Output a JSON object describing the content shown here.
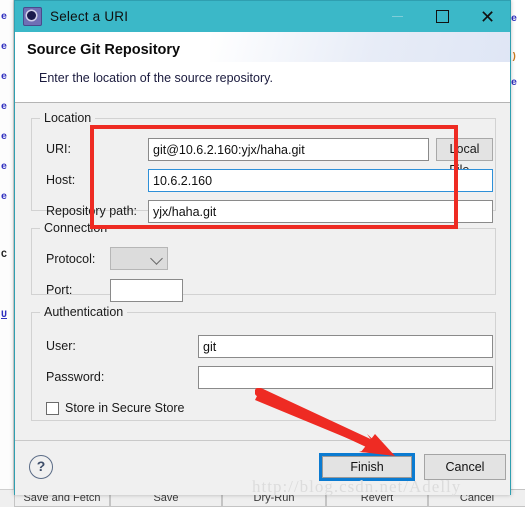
{
  "window": {
    "title": "Select a URI",
    "icon": "gear-icon",
    "controls": {
      "minimize": "—",
      "maximize": "☐",
      "close": "✕"
    },
    "titlebar_color": "#3bb8c8"
  },
  "header": {
    "title": "Source Git Repository",
    "description": "Enter the location of the source repository."
  },
  "location": {
    "legend": "Location",
    "uri": {
      "label": "URI:",
      "value": "git@10.6.2.160:yjx/haha.git"
    },
    "host": {
      "label": "Host:",
      "value": "10.6.2.160"
    },
    "repository_path": {
      "label": "Repository path:",
      "value": "yjx/haha.git"
    },
    "local_file_button": "Local File..."
  },
  "connection": {
    "legend": "Connection",
    "protocol": {
      "label": "Protocol:",
      "value": ""
    },
    "port": {
      "label": "Port:",
      "value": ""
    }
  },
  "authentication": {
    "legend": "Authentication",
    "user": {
      "label": "User:",
      "value": "git"
    },
    "password": {
      "label": "Password:",
      "value": ""
    },
    "store_in_secure_store": {
      "label": "Store in Secure Store",
      "checked": false
    }
  },
  "footer": {
    "help": "?",
    "finish": "Finish",
    "cancel": "Cancel"
  },
  "annotations": {
    "highlight_color": "#ee2b23",
    "watermark": "http://blog.csdn.net/Adelly"
  },
  "background": {
    "bottom_buttons": [
      "Save and Fetch",
      "Save",
      "Dry-Run",
      "Revert",
      "Cancel"
    ],
    "left_fragments": [
      "e",
      "e",
      "e",
      "e",
      "e",
      "e",
      "e",
      "C",
      "U"
    ],
    "right_fragments": [
      "e",
      ")",
      "e"
    ]
  }
}
